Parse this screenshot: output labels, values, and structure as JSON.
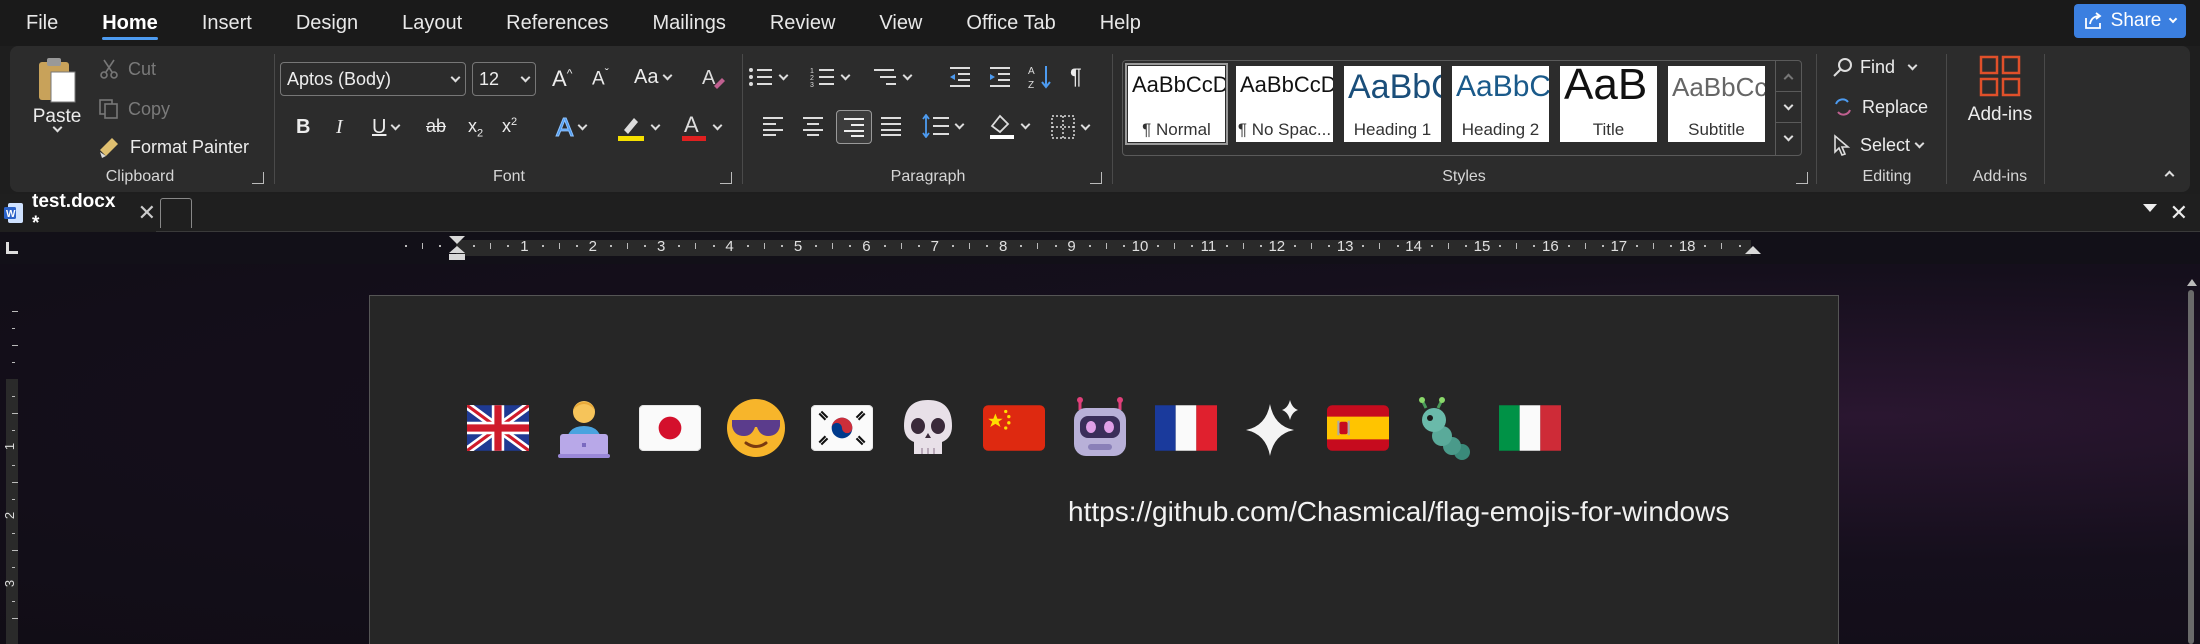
{
  "menu": {
    "items": [
      "File",
      "Home",
      "Insert",
      "Design",
      "Layout",
      "References",
      "Mailings",
      "Review",
      "View",
      "Office Tab",
      "Help"
    ],
    "active": "Home",
    "share_label": "Share"
  },
  "clipboard": {
    "paste_label": "Paste",
    "cut_label": "Cut",
    "copy_label": "Copy",
    "format_painter_label": "Format Painter",
    "group_label": "Clipboard"
  },
  "font": {
    "font_name": "Aptos (Body)",
    "font_size": "12",
    "group_label": "Font"
  },
  "paragraph": {
    "group_label": "Paragraph"
  },
  "styles": {
    "group_label": "Styles",
    "items": [
      {
        "sample": "AaBbCcDd",
        "name": "¶ Normal"
      },
      {
        "sample": "AaBbCcDd",
        "name": "¶ No Spac..."
      },
      {
        "sample": "AaBbCc",
        "name": "Heading 1"
      },
      {
        "sample": "AaBbCc",
        "name": "Heading 2"
      },
      {
        "sample": "AaB",
        "name": "Title"
      },
      {
        "sample": "AaBbCcD",
        "name": "Subtitle"
      }
    ]
  },
  "editing": {
    "find_label": "Find",
    "replace_label": "Replace",
    "select_label": "Select",
    "group_label": "Editing"
  },
  "addins": {
    "button_label": "Add-ins",
    "group_label": "Add-ins"
  },
  "tabbar": {
    "doc_tab_label": "test.docx *"
  },
  "ruler": {
    "numbers": [
      "1",
      "2",
      "3",
      "4",
      "5",
      "6",
      "7",
      "8",
      "9",
      "10",
      "11",
      "12",
      "13",
      "14",
      "15",
      "16",
      "17",
      "18"
    ]
  },
  "vruler": {
    "numbers": [
      "1",
      "2",
      "3"
    ]
  },
  "document": {
    "emojis": [
      "flag-uk",
      "technologist",
      "flag-japan",
      "sunglasses-face",
      "flag-korea",
      "skull",
      "flag-china",
      "robot",
      "flag-france",
      "sparkles",
      "flag-spain",
      "caterpillar",
      "flag-italy"
    ],
    "url_text": "https://github.com/Chasmical/flag-emojis-for-windows"
  },
  "colors": {
    "accent": "#4d9bf0",
    "share_bg": "#3b7fe0",
    "ribbon_bg": "#2c2c2c",
    "page_bg": "#262626",
    "addins_icon": "#e0502a"
  }
}
